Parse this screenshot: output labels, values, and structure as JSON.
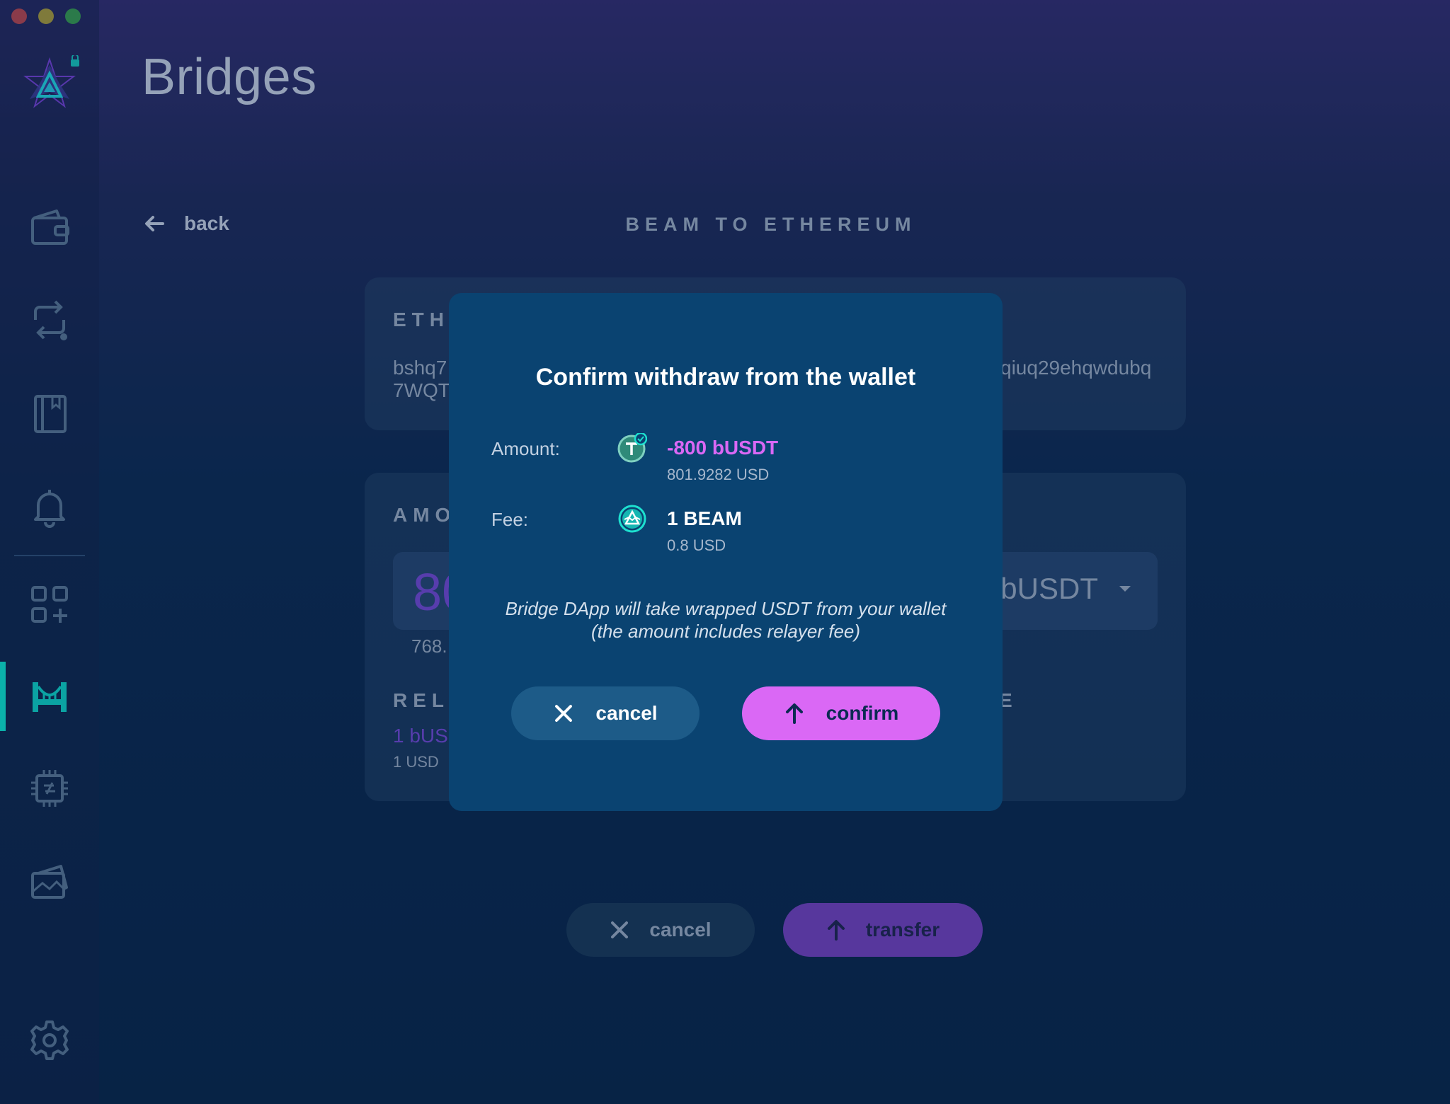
{
  "window": {
    "controls": [
      "close",
      "minimize",
      "maximize"
    ]
  },
  "sidebar": {
    "items": [
      {
        "name": "wallet",
        "icon": "wallet-icon",
        "active": false
      },
      {
        "name": "atomic-swap",
        "icon": "swap-icon",
        "active": false
      },
      {
        "name": "address-book",
        "icon": "address-book-icon",
        "active": false
      },
      {
        "name": "notifications",
        "icon": "bell-icon",
        "active": false
      },
      {
        "name": "dapps",
        "icon": "apps-grid-icon",
        "active": false
      },
      {
        "name": "bridges",
        "icon": "bridge-icon",
        "active": true
      },
      {
        "name": "utxo",
        "icon": "chip-icon",
        "active": false
      },
      {
        "name": "assets",
        "icon": "cards-icon",
        "active": false
      },
      {
        "name": "settings",
        "icon": "gear-icon",
        "active": false
      }
    ],
    "accent": "#0dd3c5"
  },
  "header": {
    "title": "Bridges"
  },
  "nav": {
    "back_label": "back",
    "section_title": "BEAM TO ETHEREUM"
  },
  "background_form": {
    "address_label": "ETHE",
    "address_line1_start": "bshq7",
    "address_line2_start": "7WQT",
    "address_line1_end": "qiuq29ehqwdubq",
    "amount_label": "AMO",
    "amount_value": "80",
    "amount_token": "bUSDT",
    "amount_usd_partial": "768.",
    "relayer_label": "RELA",
    "relayer_right_label": "E",
    "relayer_value": "1 bUSD",
    "relayer_usd": "1 USD",
    "cancel_label": "cancel",
    "transfer_label": "transfer"
  },
  "modal": {
    "title": "Confirm withdraw from the wallet",
    "amount_label": "Amount:",
    "amount_value": "-800 bUSDT",
    "amount_usd": "801.9282 USD",
    "fee_label": "Fee:",
    "fee_value": "1 BEAM",
    "fee_usd": "0.8 USD",
    "note_line1": "Bridge DApp will take wrapped USDT from your wallet",
    "note_line2": "(the amount includes relayer fee)",
    "cancel_label": "cancel",
    "confirm_label": "confirm",
    "colors": {
      "amount": "#da68f5",
      "confirm_button": "#da68f5",
      "modal_bg": "#0a4371"
    }
  }
}
